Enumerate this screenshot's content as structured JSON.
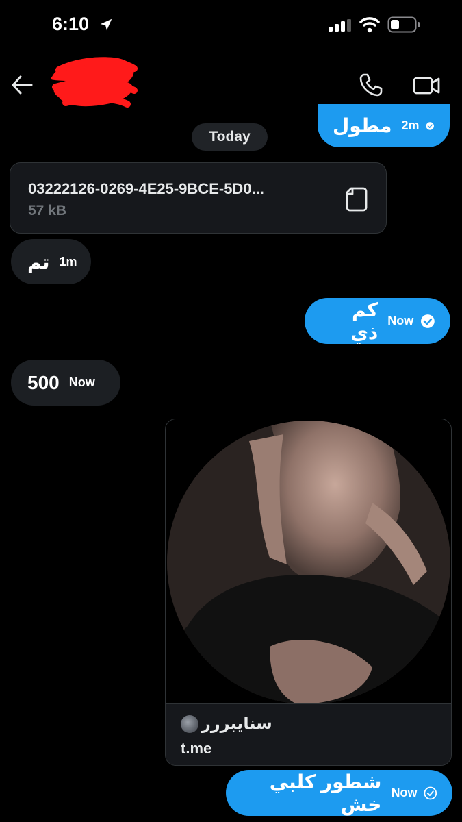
{
  "status_bar": {
    "time": "6:10"
  },
  "conversation": {
    "day_separator": "Today"
  },
  "messages": [
    {
      "direction": "outgoing",
      "text": "مطول",
      "time": "2m"
    },
    {
      "direction": "incoming",
      "type": "file",
      "filename": "03222126-0269-4E25-9BCE-5D0...",
      "size": "57 kB"
    },
    {
      "direction": "incoming",
      "text": "تم",
      "time": "1m"
    },
    {
      "direction": "outgoing",
      "text": "كم ذي",
      "time": "Now"
    },
    {
      "direction": "incoming",
      "text": "500",
      "time": "Now"
    },
    {
      "direction": "outgoing",
      "type": "link",
      "title": "سنايبررر",
      "domain": "t.me"
    },
    {
      "direction": "outgoing",
      "text": "شطور كلبي خش",
      "time": "Now"
    }
  ],
  "colors": {
    "outgoing": "#1d9bf0",
    "incoming": "#1c1f23",
    "background": "#000000"
  },
  "icons": [
    "location-arrow-icon",
    "signal-icon",
    "wifi-icon",
    "battery-icon",
    "back-arrow-icon",
    "phone-icon",
    "video-icon",
    "file-icon",
    "check-icon",
    "moon-emoji-icon"
  ]
}
